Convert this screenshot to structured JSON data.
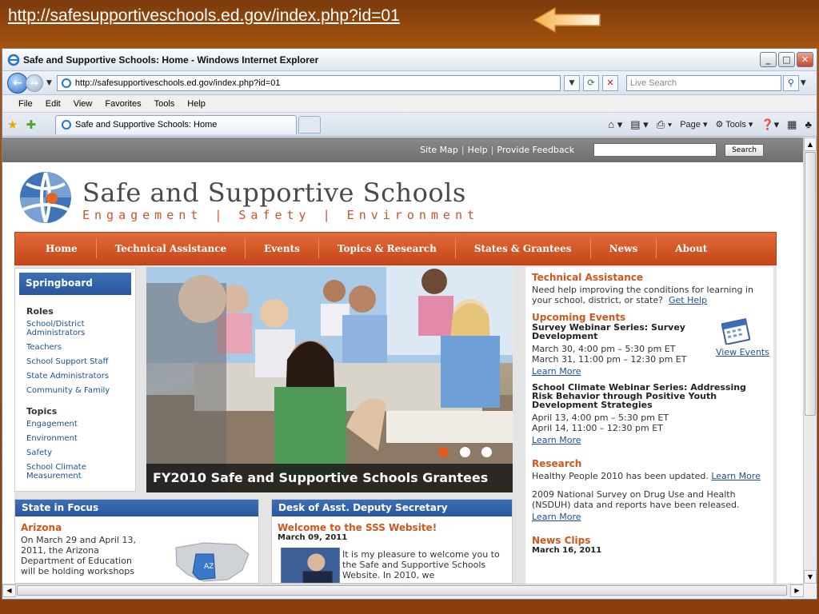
{
  "slide": {
    "url": "http://safesupportiveschools.ed.gov/index.php?id=01"
  },
  "browser": {
    "title": "Safe and Supportive Schools: Home - Windows Internet Explorer",
    "address": "http://safesupportiveschools.ed.gov/index.php?id=01",
    "search_placeholder": "Live Search",
    "menu": [
      "File",
      "Edit",
      "View",
      "Favorites",
      "Tools",
      "Help"
    ],
    "tab_title": "Safe and Supportive Schools: Home",
    "cmd": {
      "page": "Page",
      "tools": "Tools"
    }
  },
  "site": {
    "top_links": [
      "Site Map",
      "Help",
      "Provide Feedback"
    ],
    "search_button": "Search",
    "brand_title": "Safe and Supportive  Schools",
    "brand_sub": "Engagement | Safety | Environment",
    "nav": [
      "Home",
      "Technical Assistance",
      "Events",
      "Topics & Research",
      "States & Grantees",
      "News",
      "About"
    ],
    "springboard": {
      "title": "Springboard",
      "roles_heading": "Roles",
      "roles": [
        "School/District Administrators",
        "Teachers",
        "School Support Staff",
        "State Administrators",
        "Community & Family"
      ],
      "topics_heading": "Topics",
      "topics": [
        "Engagement",
        "Environment",
        "Safety",
        "School Climate Measurement"
      ]
    },
    "hero_caption": "FY2010 Safe and Supportive Schools Grantees",
    "right": {
      "ta_heading": "Technical Assistance",
      "ta_text": "Need help improving the conditions for learning in your school, district, or state?",
      "ta_link": "Get Help",
      "events_heading": "Upcoming Events",
      "view_events": "View Events",
      "event1_title": "Survey Webinar Series: Survey Development",
      "event1_date1": "March 30, 4:00 pm – 5:30 pm ET",
      "event1_date2": "March 31, 11:00 pm – 12:30 pm ET",
      "learn_more": "Learn More",
      "event2_title": "School Climate Webinar Series: Addressing Risk Behavior through Positive Youth Development Strategies",
      "event2_date1": "April 13, 4:00 pm – 5:30 pm ET",
      "event2_date2": "April 14, 11:00 – 12:30 pm ET",
      "research_heading": "Research",
      "research_text1": "Healthy People 2010 has been updated.",
      "research_text2": "2009 National Survey on Drug Use and Health (NSDUH) data and reports have been released.",
      "news_heading": "News Clips",
      "news_date": "March 16, 2011"
    },
    "state_focus": {
      "title": "State in Focus",
      "state": "Arizona",
      "text": "On March 29 and April 13, 2011, the Arizona Department of Education will be holding workshops",
      "map_label": "AZ"
    },
    "desk": {
      "title": "Desk of Asst. Deputy Secretary",
      "heading": "Welcome to the SSS Website!",
      "date": "March 09, 2011",
      "text": "It is my pleasure to welcome you to the Safe and Supportive Schools Website. In 2010, we"
    }
  }
}
